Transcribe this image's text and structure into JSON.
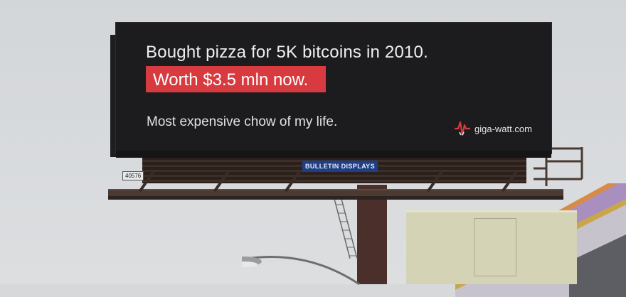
{
  "billboard": {
    "headline": "Bought pizza for 5K bitcoins in 2010.",
    "highlight": "Worth $3.5 mln now.",
    "tagline": "Most expensive chow of my life.",
    "website": "giga-watt.com",
    "accent_color": "#d73a3f",
    "background_color": "#1c1c1e"
  },
  "structure": {
    "operator_label": "BULLETIN DISPLAYS",
    "panel_number": "40576"
  },
  "icons": {
    "logo": "giga-watt-logo-icon"
  }
}
